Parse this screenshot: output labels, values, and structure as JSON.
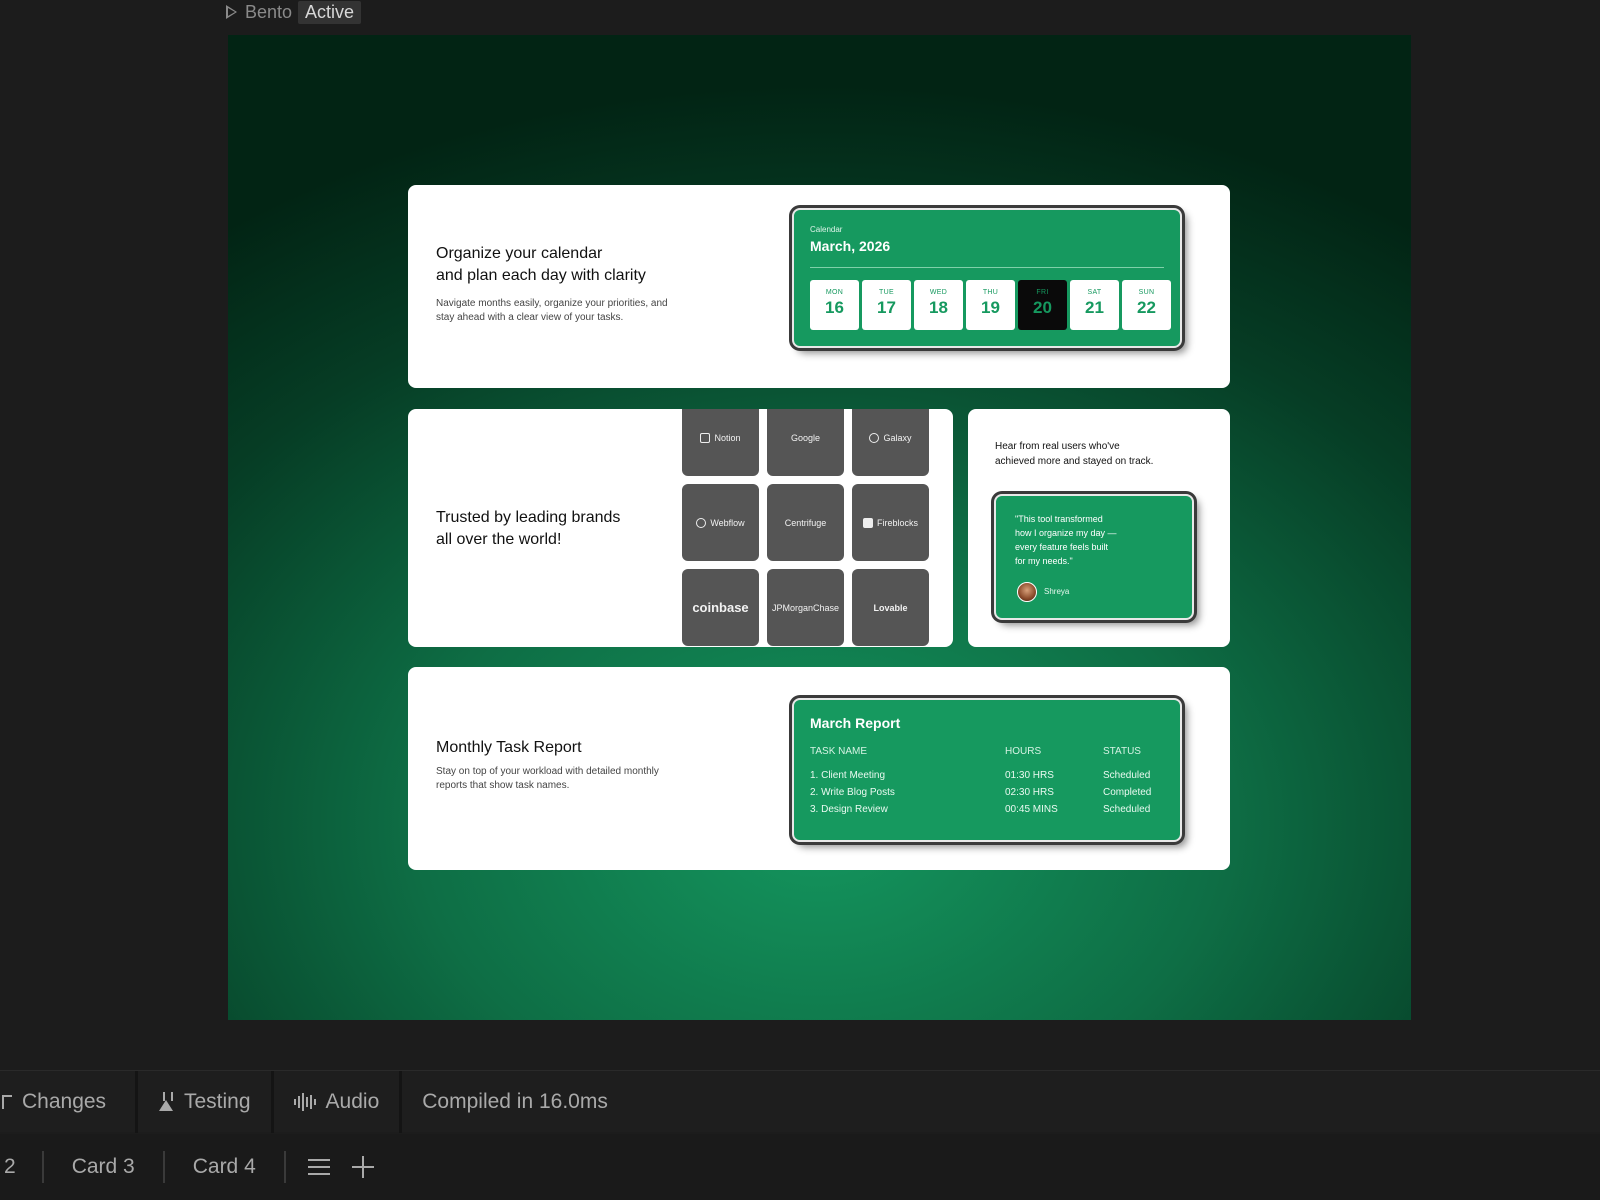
{
  "top": {
    "label": "Bento",
    "badge": "Active"
  },
  "calendar_card": {
    "heading_line1": "Organize your calendar",
    "heading_line2": "and plan each day with clarity",
    "body_line1": "Navigate months easily, organize your priorities, and",
    "body_line2": "stay ahead with a clear view of your tasks.",
    "widget_label": "Calendar",
    "month": "March, 2026",
    "days": [
      {
        "name": "MON",
        "num": "16"
      },
      {
        "name": "TUE",
        "num": "17"
      },
      {
        "name": "WED",
        "num": "18"
      },
      {
        "name": "THU",
        "num": "19"
      },
      {
        "name": "FRI",
        "num": "20",
        "selected": true
      },
      {
        "name": "SAT",
        "num": "21"
      },
      {
        "name": "SUN",
        "num": "22"
      }
    ]
  },
  "brands_card": {
    "heading_line1": "Trusted by leading brands",
    "heading_line2": "all over the world!",
    "logos": [
      "Notion",
      "Google",
      "Galaxy",
      "Webflow",
      "Centrifuge",
      "Fireblocks",
      "coinbase",
      "JPMorganChase",
      "Lovable"
    ]
  },
  "testimonial_card": {
    "heading_line1": "Hear from real users who've",
    "heading_line2": "achieved more and stayed on track.",
    "quote_line1": "\"This tool transformed",
    "quote_line2": "how I organize my day —",
    "quote_line3": "every feature feels built",
    "quote_line4": "for my needs.\"",
    "author": "Shreya"
  },
  "report_card": {
    "heading": "Monthly Task Report",
    "body_line1": "Stay on top of your workload with detailed monthly",
    "body_line2": "reports that show task names.",
    "widget_title": "March Report",
    "columns": [
      "TASK NAME",
      "HOURS",
      "STATUS"
    ],
    "rows": [
      [
        "1. Client Meeting",
        "01:30 HRS",
        "Scheduled"
      ],
      [
        "2. Write Blog Posts",
        "02:30 HRS",
        "Completed"
      ],
      [
        "3. Design Review",
        "00:45 MINS",
        "Scheduled"
      ]
    ]
  },
  "status_bar": {
    "changes": "Changes",
    "testing": "Testing",
    "audio": "Audio",
    "compiled": "Compiled in 16.0ms"
  },
  "tabs": [
    "2",
    "Card 3",
    "Card 4"
  ],
  "colors": {
    "accent": "#16995f",
    "background": "#1c1c1c"
  }
}
